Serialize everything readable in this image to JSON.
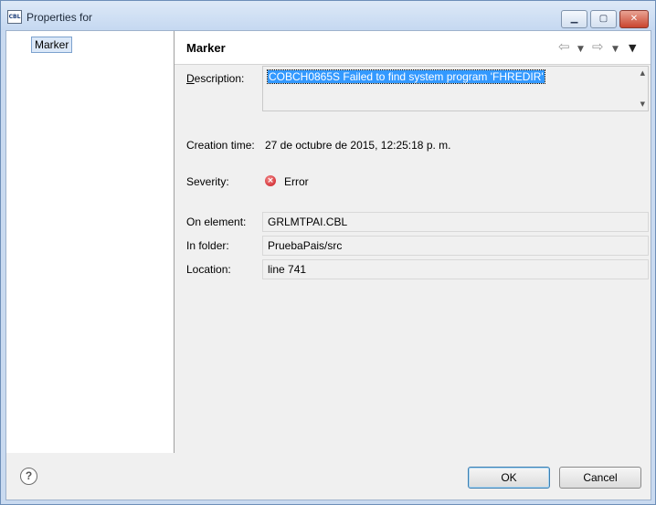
{
  "window": {
    "title": "Properties for",
    "app_icon": "CBL",
    "minimize_icon": "minimize-icon",
    "maximize_icon": "maximize-icon",
    "close_icon": "close-icon"
  },
  "tree": {
    "items": [
      {
        "label": "Marker",
        "selected": true
      }
    ]
  },
  "page": {
    "title": "Marker",
    "nav": {
      "back_icon": "back-arrow-icon",
      "forward_icon": "forward-arrow-icon",
      "menu_icon": "view-menu-icon"
    }
  },
  "fields": {
    "description": {
      "label": "Description:",
      "value": "COBCH0865S Failed to find system program 'FHREDIR'"
    },
    "creation_time": {
      "label": "Creation time:",
      "value": "27 de octubre de 2015, 12:25:18 p. m."
    },
    "severity": {
      "label": "Severity:",
      "value": "Error",
      "icon": "error-icon"
    },
    "on_element": {
      "label": "On element:",
      "value": "GRLMTPAI.CBL"
    },
    "in_folder": {
      "label": "In folder:",
      "value": "PruebaPais/src"
    },
    "location": {
      "label": "Location:",
      "value": "line 741"
    }
  },
  "buttons": {
    "ok": "OK",
    "cancel": "Cancel",
    "help_icon": "help-icon"
  },
  "colors": {
    "selection": "#3399ff",
    "error": "#c8141c",
    "title_bar": "#c5d8f1"
  }
}
